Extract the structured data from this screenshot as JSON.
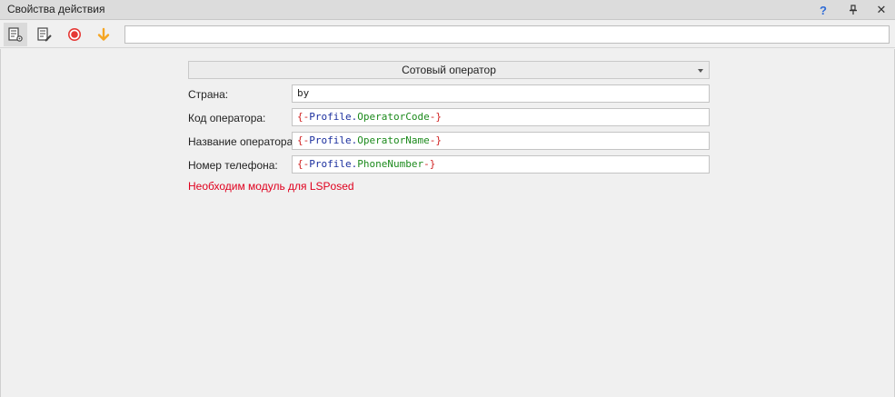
{
  "window": {
    "title": "Свойства действия",
    "help_label": "?",
    "pin_label": "🖈",
    "close_label": "✕"
  },
  "toolbar": {
    "icons": [
      "properties-icon",
      "edit-properties-icon",
      "record-icon",
      "arrow-down-icon"
    ],
    "input_value": ""
  },
  "form": {
    "dropdown_value": "Сотовый оператор",
    "fields": [
      {
        "label": "Страна:",
        "value": "by",
        "tokens": [
          {
            "t": "by",
            "c": "plain"
          }
        ]
      },
      {
        "label": "Код оператора:",
        "value": "{-Profile.OperatorCode-}",
        "tokens": [
          {
            "t": "{-",
            "c": "br"
          },
          {
            "t": "Profile",
            "c": "kw"
          },
          {
            "t": ".",
            "c": "dot"
          },
          {
            "t": "OperatorCode",
            "c": "prop"
          },
          {
            "t": "-}",
            "c": "br"
          }
        ]
      },
      {
        "label": "Название оператора:",
        "value": "{-Profile.OperatorName-}",
        "tokens": [
          {
            "t": "{-",
            "c": "br"
          },
          {
            "t": "Profile",
            "c": "kw"
          },
          {
            "t": ".",
            "c": "dot"
          },
          {
            "t": "OperatorName",
            "c": "prop"
          },
          {
            "t": "-}",
            "c": "br"
          }
        ]
      },
      {
        "label": "Номер телефона:",
        "value": "{-Profile.PhoneNumber-}",
        "tokens": [
          {
            "t": "{-",
            "c": "br"
          },
          {
            "t": "Profile",
            "c": "kw"
          },
          {
            "t": ".",
            "c": "dot"
          },
          {
            "t": "PhoneNumber",
            "c": "prop"
          },
          {
            "t": "-}",
            "c": "br"
          }
        ]
      }
    ],
    "warning": "Необходим модуль для LSPosed"
  },
  "colors": {
    "warning": "#e0001e",
    "record": "#e53935",
    "arrow": "#f5a623",
    "help": "#2e6bd6"
  }
}
